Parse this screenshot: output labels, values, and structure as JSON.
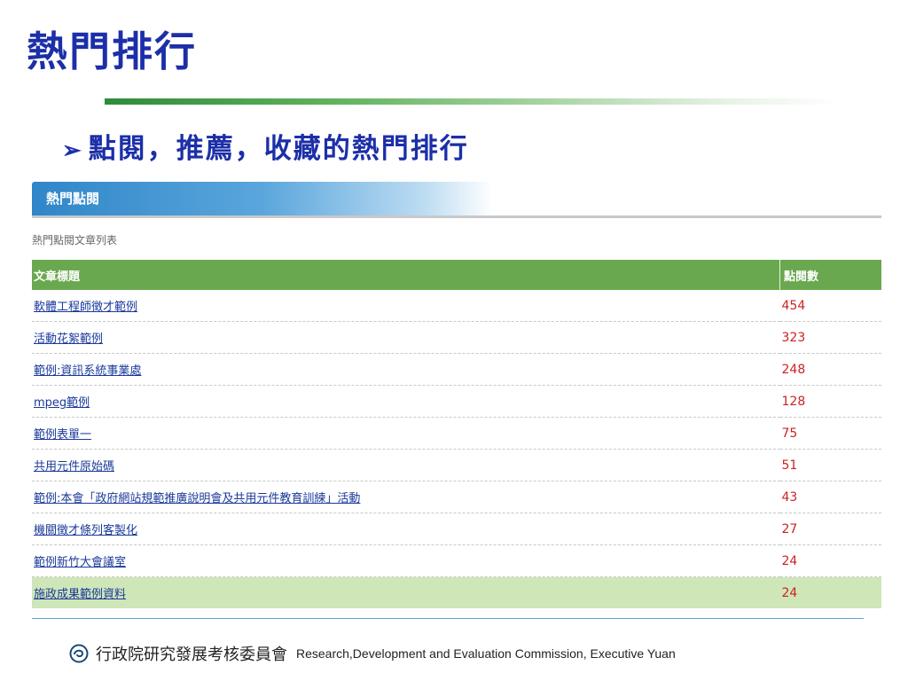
{
  "slide": {
    "title": "熱門排行",
    "bullet_marker": "➢",
    "bullet": "點閱，推薦，收藏的熱門排行"
  },
  "panel": {
    "tab_label": "熱門點閱",
    "caption": "熱門點閱文章列表",
    "columns": [
      "文章標題",
      "點閱數"
    ],
    "rows": [
      {
        "title": "軟體工程師徵才範例",
        "views": "454"
      },
      {
        "title": "活動花絮範例",
        "views": "323"
      },
      {
        "title": "範例:資訊系統事業處",
        "views": "248"
      },
      {
        "title": "mpeg範例",
        "views": "128"
      },
      {
        "title": "範例表單一",
        "views": "75"
      },
      {
        "title": "共用元件原始碼",
        "views": "51"
      },
      {
        "title": "範例:本會「政府網站規範推廣說明會及共用元件教育訓練」活動",
        "views": "43"
      },
      {
        "title": "機關徵才條列客製化",
        "views": "27"
      },
      {
        "title": "範例新竹大會議室",
        "views": "24"
      },
      {
        "title": "施政成果範例資料",
        "views": "24"
      }
    ]
  },
  "footer": {
    "org_zh": "行政院研究發展考核委員會",
    "org_en": "Research,Development and Evaluation Commission, Executive Yuan",
    "logo_icon": "rdec-logo-icon"
  },
  "colors": {
    "title": "#1c2fa8",
    "header_green": "#6aa84f",
    "highlight_row": "#cfe6b8",
    "tab_blue": "#2f86c8",
    "count_red": "#cc2222"
  }
}
